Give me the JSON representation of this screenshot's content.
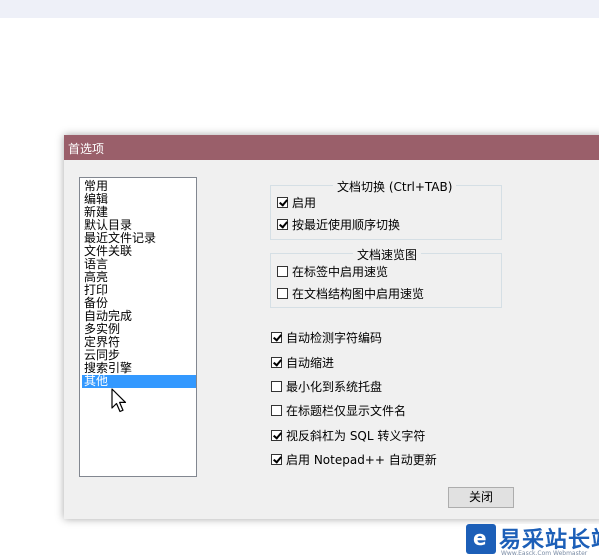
{
  "window": {
    "title": "首选项"
  },
  "categories": [
    {
      "label": "常用"
    },
    {
      "label": "编辑"
    },
    {
      "label": "新建"
    },
    {
      "label": "默认目录"
    },
    {
      "label": "最近文件记录"
    },
    {
      "label": "文件关联"
    },
    {
      "label": "语言"
    },
    {
      "label": "高亮"
    },
    {
      "label": "打印"
    },
    {
      "label": "备份"
    },
    {
      "label": "自动完成"
    },
    {
      "label": "多实例"
    },
    {
      "label": "定界符"
    },
    {
      "label": "云同步"
    },
    {
      "label": "搜索引擎"
    },
    {
      "label": "其他",
      "selected": true
    }
  ],
  "tab_switch": {
    "title": "文档切换 (Ctrl+TAB)",
    "enable_label": "启用",
    "enable_checked": true,
    "mru_label": "按最近使用顺序切换",
    "mru_checked": true
  },
  "doc_peek": {
    "title": "文档速览图",
    "tab_label": "在标签中启用速览",
    "tab_checked": false,
    "map_label": "在文档结构图中启用速览",
    "map_checked": false
  },
  "options": [
    {
      "label": "自动检测字符编码",
      "checked": true
    },
    {
      "label": "自动缩进",
      "checked": true
    },
    {
      "label": "最小化到系统托盘",
      "checked": false
    },
    {
      "label": "在标题栏仅显示文件名",
      "checked": false
    },
    {
      "label": "视反斜杠为 SQL 转义字符",
      "checked": true
    },
    {
      "label": "启用 Notepad++ 自动更新",
      "checked": true
    }
  ],
  "buttons": {
    "close": "关闭"
  },
  "watermark": {
    "text": "易采站长站",
    "sub": "Www.Easck.Com Webmaster"
  },
  "colors": {
    "titlebar": "#9a5f6a",
    "selection": "#3399ff"
  }
}
